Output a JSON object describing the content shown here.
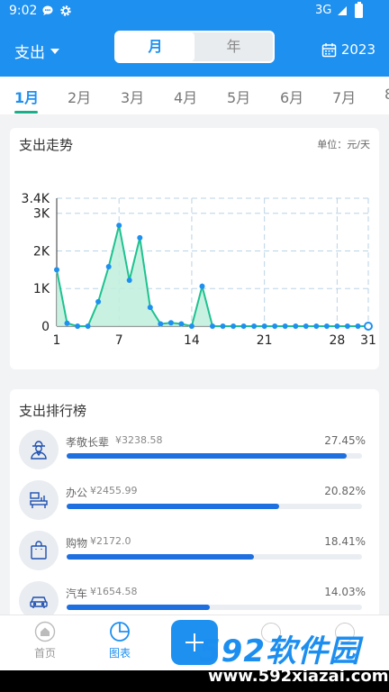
{
  "status_bar": {
    "time": "9:02",
    "network": "3G"
  },
  "header": {
    "type_label": "支出",
    "seg_month": "月",
    "seg_year": "年",
    "year": "2023"
  },
  "month_tabs": [
    "1月",
    "2月",
    "3月",
    "4月",
    "5月",
    "6月",
    "7月",
    "8"
  ],
  "trend": {
    "title": "支出走势",
    "unit": "单位：元/天"
  },
  "chart_data": {
    "type": "area",
    "x": [
      1,
      2,
      3,
      4,
      5,
      6,
      7,
      8,
      9,
      10,
      11,
      12,
      13,
      14,
      15,
      16,
      17,
      18,
      19,
      20,
      21,
      22,
      23,
      24,
      25,
      26,
      27,
      28,
      29,
      30,
      31
    ],
    "values": [
      1500,
      80,
      0,
      0,
      650,
      1580,
      2680,
      1220,
      2350,
      500,
      60,
      90,
      60,
      0,
      1060,
      0,
      0,
      0,
      0,
      0,
      0,
      0,
      0,
      0,
      0,
      0,
      0,
      0,
      0,
      0,
      0
    ],
    "y_ticks": [
      "0",
      "1K",
      "2K",
      "3K",
      "3.4K"
    ],
    "y_tick_values": [
      0,
      1000,
      2000,
      3000,
      3400
    ],
    "x_tick_labels": [
      "1",
      "7",
      "14",
      "21",
      "28",
      "31"
    ],
    "x_tick_values": [
      1,
      7,
      14,
      21,
      28,
      31
    ],
    "ylim": [
      0,
      3400
    ],
    "xlim": [
      1,
      31
    ],
    "colors": {
      "line": "#1ec28f",
      "fill": "#bfeedd",
      "point": "#1e90f0",
      "grid": "#b9d3e6"
    },
    "grid": true
  },
  "ranking": {
    "title": "支出排行榜",
    "items": [
      {
        "name": "孝敬长辈",
        "amount": "¥3238.58",
        "percent": "27.45%",
        "share": 0.2745,
        "icon": "elder-icon"
      },
      {
        "name": "办公",
        "amount": "¥2455.99",
        "percent": "20.82%",
        "share": 0.2082,
        "icon": "office-icon"
      },
      {
        "name": "购物",
        "amount": "¥2172.0",
        "percent": "18.41%",
        "share": 0.1841,
        "icon": "shopping-bag-icon"
      },
      {
        "name": "汽车",
        "amount": "¥1654.58",
        "percent": "14.03%",
        "share": 0.1403,
        "icon": "car-icon"
      }
    ]
  },
  "bottom_nav": {
    "home": "首页",
    "chart": "图表"
  },
  "watermark": {
    "main": "592软件园",
    "url": "www.592xiazai.com"
  }
}
